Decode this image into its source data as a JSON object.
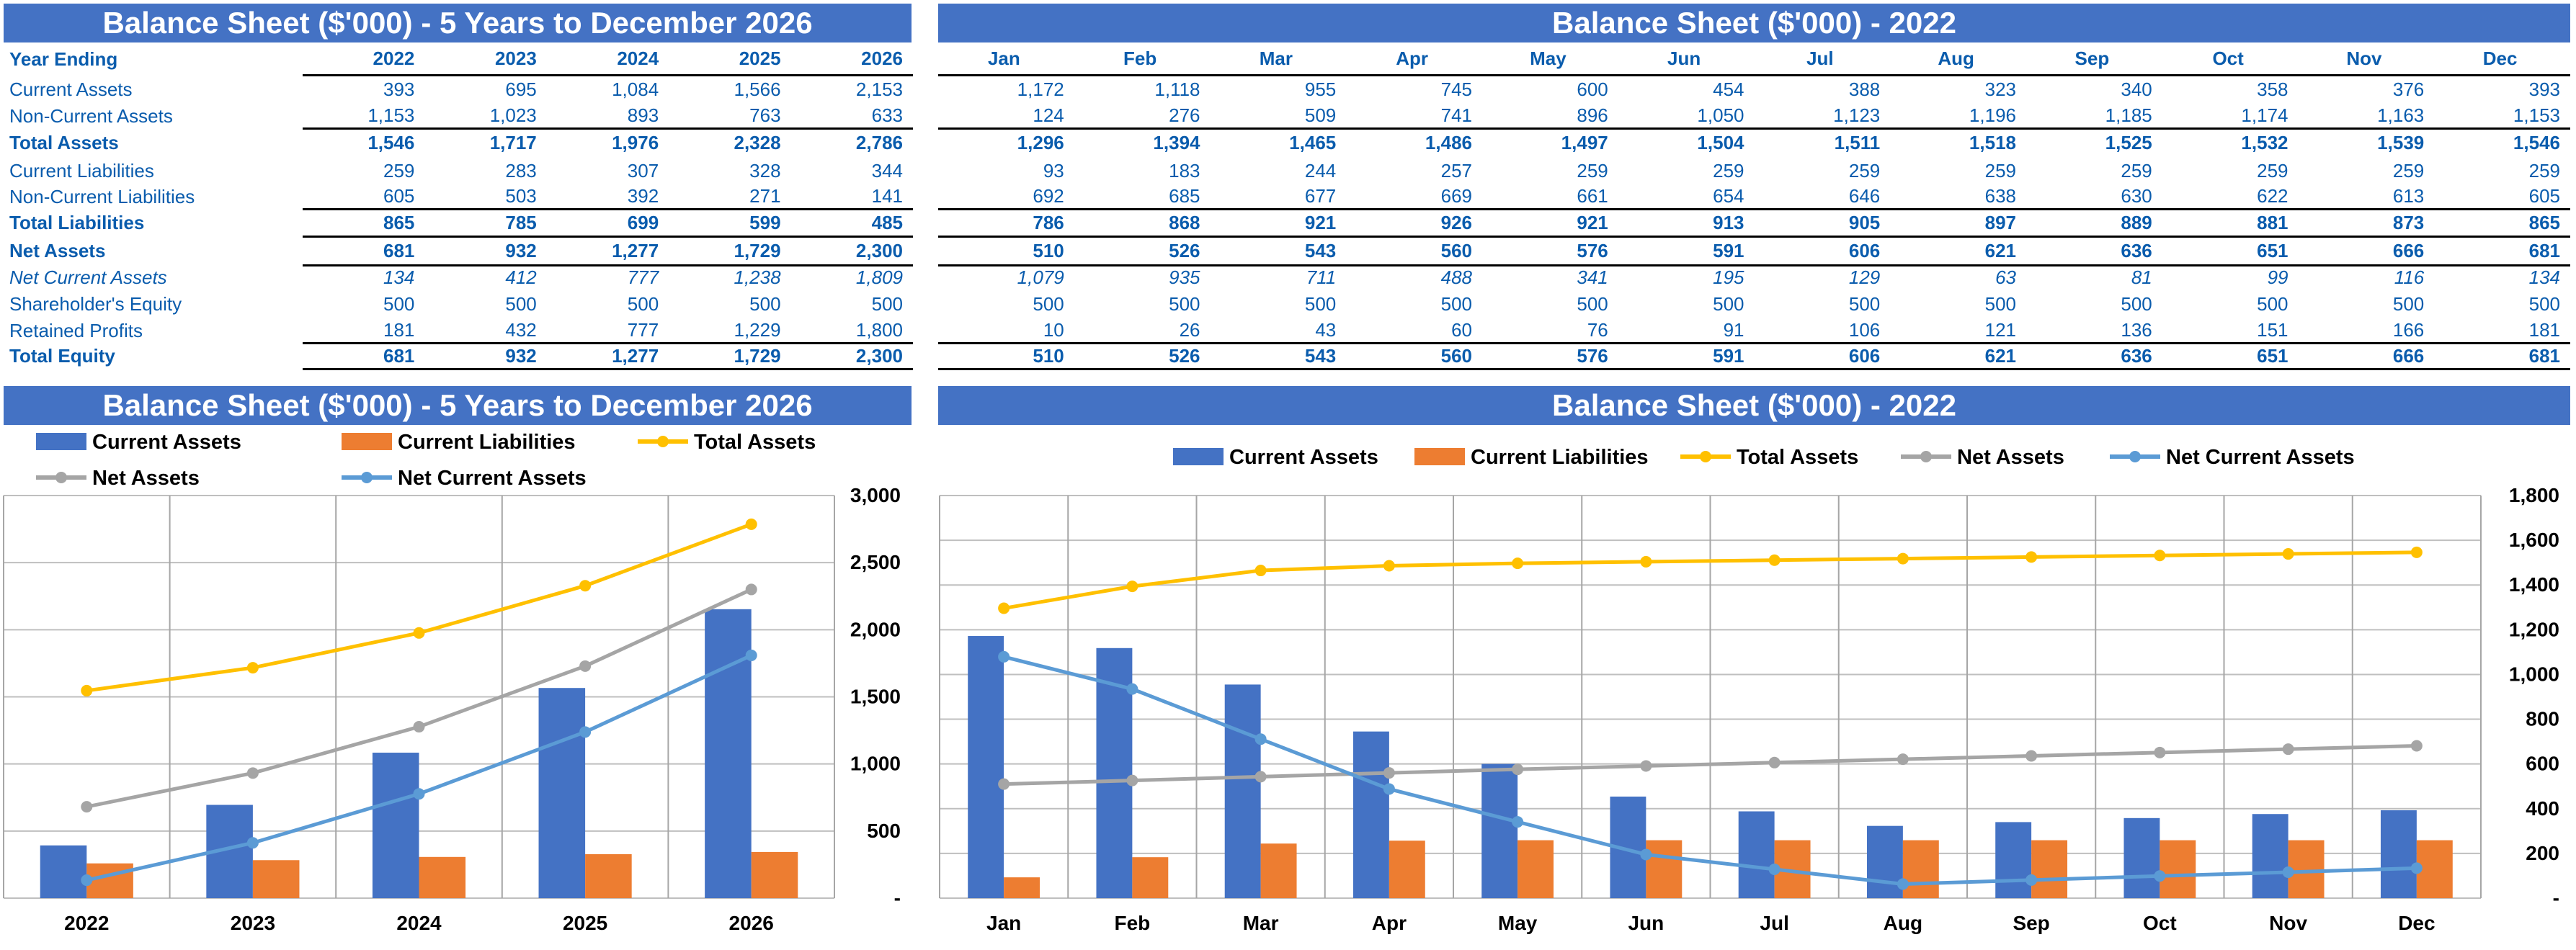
{
  "colors": {
    "header_bg": "#4472C4",
    "text": "#0a5cad",
    "current_assets": "#4472C4",
    "current_liabilities": "#ED7D31",
    "total_assets": "#FFC000",
    "net_assets": "#A5A5A5",
    "net_current_assets": "#5B9BD5"
  },
  "five_year": {
    "title": "Balance Sheet ($'000) - 5 Years to December 2026",
    "header_label": "Year Ending",
    "columns": [
      "2022",
      "2023",
      "2024",
      "2025",
      "2026"
    ],
    "rows": [
      {
        "label": "Current Assets",
        "style": "normal",
        "values": [
          "393",
          "695",
          "1,084",
          "1,566",
          "2,153"
        ]
      },
      {
        "label": "Non-Current Assets",
        "style": "normal",
        "values": [
          "1,153",
          "1,023",
          "893",
          "763",
          "633"
        ]
      },
      {
        "label": "Total Assets",
        "style": "bold",
        "values": [
          "1,546",
          "1,717",
          "1,976",
          "2,328",
          "2,786"
        ]
      },
      {
        "label": "Current Liabilities",
        "style": "normal",
        "values": [
          "259",
          "283",
          "307",
          "328",
          "344"
        ]
      },
      {
        "label": "Non-Current Liabilities",
        "style": "normal",
        "values": [
          "605",
          "503",
          "392",
          "271",
          "141"
        ]
      },
      {
        "label": "Total Liabilities",
        "style": "bold",
        "values": [
          "865",
          "785",
          "699",
          "599",
          "485"
        ]
      },
      {
        "label": "Net Assets",
        "style": "bold",
        "values": [
          "681",
          "932",
          "1,277",
          "1,729",
          "2,300"
        ]
      },
      {
        "label": "Net Current Assets",
        "style": "italic",
        "values": [
          "134",
          "412",
          "777",
          "1,238",
          "1,809"
        ]
      },
      {
        "label": "Shareholder's Equity",
        "style": "normal",
        "values": [
          "500",
          "500",
          "500",
          "500",
          "500"
        ]
      },
      {
        "label": "Retained Profits",
        "style": "normal",
        "values": [
          "181",
          "432",
          "777",
          "1,229",
          "1,800"
        ]
      },
      {
        "label": "Total Equity",
        "style": "bold",
        "values": [
          "681",
          "932",
          "1,277",
          "1,729",
          "2,300"
        ]
      }
    ]
  },
  "monthly": {
    "title": "Balance Sheet ($'000) - 2022",
    "columns": [
      "Jan",
      "Feb",
      "Mar",
      "Apr",
      "May",
      "Jun",
      "Jul",
      "Aug",
      "Sep",
      "Oct",
      "Nov",
      "Dec"
    ],
    "rows": [
      {
        "style": "normal",
        "values": [
          "1,172",
          "1,118",
          "955",
          "745",
          "600",
          "454",
          "388",
          "323",
          "340",
          "358",
          "376",
          "393"
        ]
      },
      {
        "style": "normal",
        "values": [
          "124",
          "276",
          "509",
          "741",
          "896",
          "1,050",
          "1,123",
          "1,196",
          "1,185",
          "1,174",
          "1,163",
          "1,153"
        ]
      },
      {
        "style": "bold",
        "values": [
          "1,296",
          "1,394",
          "1,465",
          "1,486",
          "1,497",
          "1,504",
          "1,511",
          "1,518",
          "1,525",
          "1,532",
          "1,539",
          "1,546"
        ]
      },
      {
        "style": "normal",
        "values": [
          "93",
          "183",
          "244",
          "257",
          "259",
          "259",
          "259",
          "259",
          "259",
          "259",
          "259",
          "259"
        ]
      },
      {
        "style": "normal",
        "values": [
          "692",
          "685",
          "677",
          "669",
          "661",
          "654",
          "646",
          "638",
          "630",
          "622",
          "613",
          "605"
        ]
      },
      {
        "style": "bold",
        "values": [
          "786",
          "868",
          "921",
          "926",
          "921",
          "913",
          "905",
          "897",
          "889",
          "881",
          "873",
          "865"
        ]
      },
      {
        "style": "bold",
        "values": [
          "510",
          "526",
          "543",
          "560",
          "576",
          "591",
          "606",
          "621",
          "636",
          "651",
          "666",
          "681"
        ]
      },
      {
        "style": "italic",
        "values": [
          "1,079",
          "935",
          "711",
          "488",
          "341",
          "195",
          "129",
          "63",
          "81",
          "99",
          "116",
          "134"
        ]
      },
      {
        "style": "normal",
        "values": [
          "500",
          "500",
          "500",
          "500",
          "500",
          "500",
          "500",
          "500",
          "500",
          "500",
          "500",
          "500"
        ]
      },
      {
        "style": "normal",
        "values": [
          "10",
          "26",
          "43",
          "60",
          "76",
          "91",
          "106",
          "121",
          "136",
          "151",
          "166",
          "181"
        ]
      },
      {
        "style": "bold",
        "values": [
          "510",
          "526",
          "543",
          "560",
          "576",
          "591",
          "606",
          "621",
          "636",
          "651",
          "666",
          "681"
        ]
      }
    ]
  },
  "chart_data": [
    {
      "type": "bar+line",
      "title": "Balance Sheet ($'000) - 5 Years to December 2026",
      "categories": [
        "2022",
        "2023",
        "2024",
        "2025",
        "2026"
      ],
      "ylim": [
        0,
        3000
      ],
      "yticks": [
        "-",
        "500",
        "1,000",
        "1,500",
        "2,000",
        "2,500",
        "3,000"
      ],
      "ytick_values": [
        0,
        500,
        1000,
        1500,
        2000,
        2500,
        3000
      ],
      "y_axis_side": "right",
      "grid": true,
      "legend": "top",
      "series": [
        {
          "name": "Current Assets",
          "kind": "bar",
          "color": "#4472C4",
          "values": [
            393,
            695,
            1084,
            1566,
            2153
          ]
        },
        {
          "name": "Current Liabilities",
          "kind": "bar",
          "color": "#ED7D31",
          "values": [
            259,
            283,
            307,
            328,
            344
          ]
        },
        {
          "name": "Total Assets",
          "kind": "line",
          "color": "#FFC000",
          "values": [
            1546,
            1717,
            1976,
            2328,
            2786
          ]
        },
        {
          "name": "Net Assets",
          "kind": "line",
          "color": "#A5A5A5",
          "values": [
            681,
            932,
            1277,
            1729,
            2300
          ]
        },
        {
          "name": "Net Current Assets",
          "kind": "line",
          "color": "#5B9BD5",
          "values": [
            134,
            412,
            777,
            1238,
            1809
          ]
        }
      ]
    },
    {
      "type": "bar+line",
      "title": "Balance Sheet ($'000) - 2022",
      "categories": [
        "Jan",
        "Feb",
        "Mar",
        "Apr",
        "May",
        "Jun",
        "Jul",
        "Aug",
        "Sep",
        "Oct",
        "Nov",
        "Dec"
      ],
      "ylim": [
        0,
        1800
      ],
      "yticks": [
        "-",
        "200",
        "400",
        "600",
        "800",
        "1,000",
        "1,200",
        "1,400",
        "1,600",
        "1,800"
      ],
      "ytick_values": [
        0,
        200,
        400,
        600,
        800,
        1000,
        1200,
        1400,
        1600,
        1800
      ],
      "y_axis_side": "right",
      "grid": true,
      "legend": "top",
      "series": [
        {
          "name": "Current Assets",
          "kind": "bar",
          "color": "#4472C4",
          "values": [
            1172,
            1118,
            955,
            745,
            600,
            454,
            388,
            323,
            340,
            358,
            376,
            393
          ]
        },
        {
          "name": "Current Liabilities",
          "kind": "bar",
          "color": "#ED7D31",
          "values": [
            93,
            183,
            244,
            257,
            259,
            259,
            259,
            259,
            259,
            259,
            259,
            259
          ]
        },
        {
          "name": "Total Assets",
          "kind": "line",
          "color": "#FFC000",
          "values": [
            1296,
            1394,
            1465,
            1486,
            1497,
            1504,
            1511,
            1518,
            1525,
            1532,
            1539,
            1546
          ]
        },
        {
          "name": "Net Assets",
          "kind": "line",
          "color": "#A5A5A5",
          "values": [
            510,
            526,
            543,
            560,
            576,
            591,
            606,
            621,
            636,
            651,
            666,
            681
          ]
        },
        {
          "name": "Net Current Assets",
          "kind": "line",
          "color": "#5B9BD5",
          "values": [
            1079,
            935,
            711,
            488,
            341,
            195,
            129,
            63,
            81,
            99,
            116,
            134
          ]
        }
      ]
    }
  ]
}
